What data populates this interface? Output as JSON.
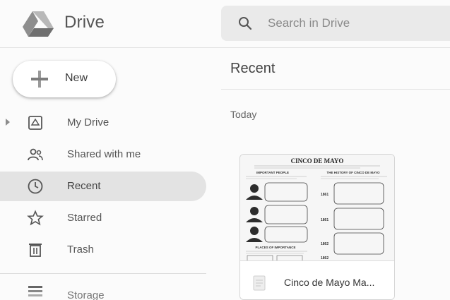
{
  "app": {
    "name": "Drive"
  },
  "search": {
    "placeholder": "Search in Drive"
  },
  "sidebar": {
    "new_label": "New",
    "items": [
      {
        "label": "My Drive",
        "icon": "my-drive-icon"
      },
      {
        "label": "Shared with me",
        "icon": "shared-with-me-icon"
      },
      {
        "label": "Recent",
        "icon": "clock-icon",
        "active": true
      },
      {
        "label": "Starred",
        "icon": "star-icon"
      },
      {
        "label": "Trash",
        "icon": "trash-icon"
      }
    ],
    "storage_label": "Storage"
  },
  "main": {
    "title": "Recent",
    "section": "Today",
    "files": [
      {
        "name": "Cinco de Mayo Ma...",
        "thumb_title": "CINCO DE MAYO",
        "thumb_headings": [
          "IMPORTANT PEOPLE",
          "THE HISTORY OF CINCO DE MAYO",
          "PLACES OF IMPORTANCE"
        ],
        "thumb_years": [
          "1861",
          "1861",
          "1862",
          "1862"
        ]
      }
    ]
  },
  "colors": {
    "active_bg": "#e3e3e3",
    "search_bg": "#eaeaea",
    "page_bg": "#fbfbfb"
  }
}
